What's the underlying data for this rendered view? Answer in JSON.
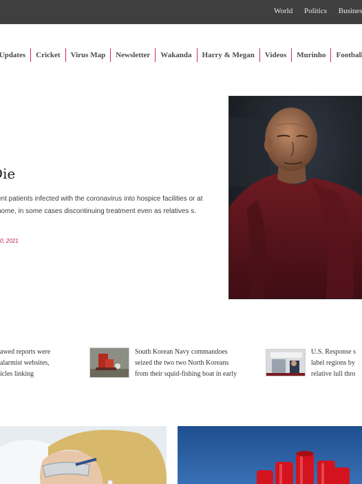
{
  "topbar": {
    "links": [
      "World",
      "Politics",
      "Business"
    ]
  },
  "nav": {
    "items": [
      "e Updates",
      "Cricket",
      "Virus Map",
      "Newsletter",
      "Wakanda",
      "Harry & Megan",
      "Videos",
      "Murinho",
      "Football"
    ]
  },
  "hero": {
    "title": "Die",
    "summary": "ent patients infected with the coronavirus into hospice facilities or at home, in some cases discontinuing treatment even as relatives s.",
    "date": "0, 2021"
  },
  "strip": {
    "story1": [
      "awed reports were",
      "alarmist websites,",
      "icles linking"
    ],
    "story2": [
      "South Korean Navy commandoes",
      "seized the two two North Koreans",
      "from their squid-fishing boat in early"
    ],
    "story3": [
      "U.S. Response s",
      "label regions by",
      "relative lull thro"
    ]
  },
  "colors": {
    "accent": "#d0275a",
    "topbar": "#3f3f3f"
  }
}
